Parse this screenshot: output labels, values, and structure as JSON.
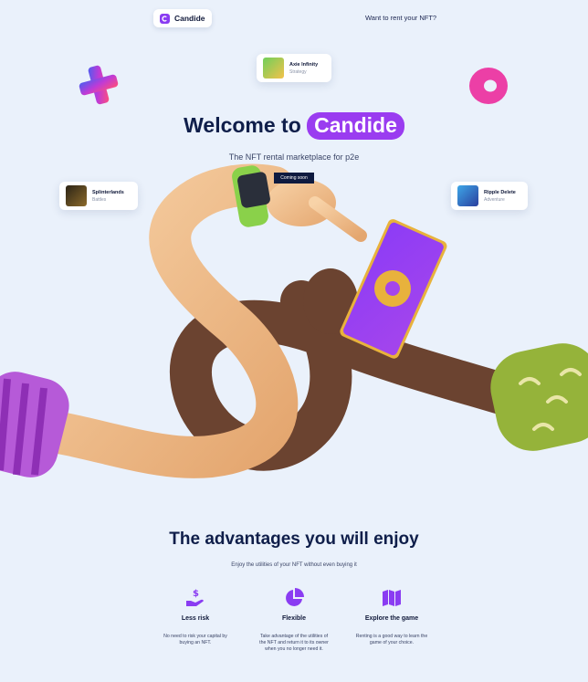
{
  "header": {
    "logo_text": "Candide",
    "rent_link": "Want to rent your NFT?"
  },
  "cards": [
    {
      "name": "Axie Infinity",
      "genre": "Strategy"
    },
    {
      "name": "Splinterlands",
      "genre": "Battles"
    },
    {
      "name": "Ripple Delete",
      "genre": "Adventure"
    }
  ],
  "hero": {
    "title_prefix": "Welcome to",
    "title_accent": "Candide",
    "subtitle": "The NFT rental marketplace for p2e",
    "badge": "Coming soon"
  },
  "advantages": {
    "title": "The advantages you will enjoy",
    "subtitle": "Enjoy the utilities of your NFT without even buying it",
    "features": [
      {
        "icon": "money-hand-icon",
        "title": "Less risk",
        "desc": "No need to risk your capital by buying an NFT."
      },
      {
        "icon": "pie-chart-icon",
        "title": "Flexible",
        "desc": "Take advantage of the utilities of the NFT and return it to its owner when you no longer need it."
      },
      {
        "icon": "map-icon",
        "title": "Explore the game",
        "desc": "Renting is a good way to learn the game of your choice."
      }
    ]
  },
  "colors": {
    "background": "#eaf1fb",
    "accent": "#9a3cf0",
    "navy": "#0f1e4a",
    "badge_bg": "#0e1a3f"
  }
}
